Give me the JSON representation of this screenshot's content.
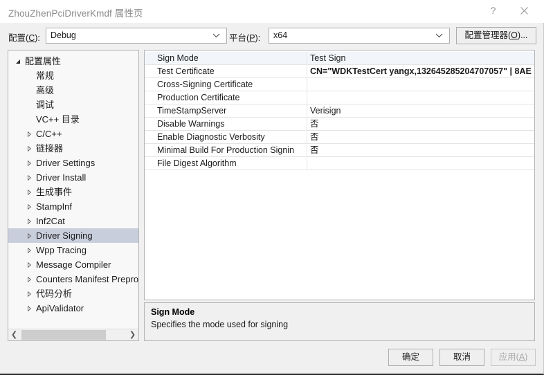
{
  "window": {
    "title": "ZhouZhenPciDriverKmdf 属性页",
    "help_icon": "question-mark-icon",
    "close_icon": "close-icon"
  },
  "config_bar": {
    "config_label": "配置(C):",
    "config_label_plain": "配置",
    "config_accel": "C",
    "config_value": "Debug",
    "platform_label": "平台(P):",
    "platform_label_plain": "平台",
    "platform_accel": "P",
    "platform_value": "x64",
    "config_manager_button": "配置管理器(O)...",
    "config_manager_plain": "配置管理器",
    "config_manager_accel": "O",
    "chevron_icon": "chevron-down-icon"
  },
  "tree": {
    "items": [
      {
        "label": "配置属性",
        "level": 0,
        "expander": "expanded",
        "selected": false
      },
      {
        "label": "常规",
        "level": 1,
        "expander": "none",
        "selected": false
      },
      {
        "label": "高级",
        "level": 1,
        "expander": "none",
        "selected": false
      },
      {
        "label": "调试",
        "level": 1,
        "expander": "none",
        "selected": false
      },
      {
        "label": "VC++ 目录",
        "level": 1,
        "expander": "none",
        "selected": false
      },
      {
        "label": "C/C++",
        "level": 1,
        "expander": "collapsed",
        "selected": false
      },
      {
        "label": "链接器",
        "level": 1,
        "expander": "collapsed",
        "selected": false
      },
      {
        "label": "Driver Settings",
        "level": 1,
        "expander": "collapsed",
        "selected": false
      },
      {
        "label": "Driver Install",
        "level": 1,
        "expander": "collapsed",
        "selected": false
      },
      {
        "label": "生成事件",
        "level": 1,
        "expander": "collapsed",
        "selected": false
      },
      {
        "label": "StampInf",
        "level": 1,
        "expander": "collapsed",
        "selected": false
      },
      {
        "label": "Inf2Cat",
        "level": 1,
        "expander": "collapsed",
        "selected": false
      },
      {
        "label": "Driver Signing",
        "level": 1,
        "expander": "collapsed",
        "selected": true
      },
      {
        "label": "Wpp Tracing",
        "level": 1,
        "expander": "collapsed",
        "selected": false
      },
      {
        "label": "Message Compiler",
        "level": 1,
        "expander": "collapsed",
        "selected": false
      },
      {
        "label": "Counters Manifest Preproc",
        "level": 1,
        "expander": "collapsed",
        "selected": false
      },
      {
        "label": "代码分析",
        "level": 1,
        "expander": "collapsed",
        "selected": false
      },
      {
        "label": "ApiValidator",
        "level": 1,
        "expander": "collapsed",
        "selected": false
      }
    ],
    "scrollbar": {
      "left_arrow_icon": "chevron-left-icon",
      "right_arrow_icon": "chevron-right-icon"
    }
  },
  "grid": {
    "rows": [
      {
        "name": "Sign Mode",
        "value": "Test Sign",
        "bold": false,
        "selected": true
      },
      {
        "name": "Test Certificate",
        "value": "CN=\"WDKTestCert yangx,132645285204707057\" | 8AE",
        "bold": true,
        "selected": false
      },
      {
        "name": "Cross-Signing Certificate",
        "value": "",
        "bold": false,
        "selected": false
      },
      {
        "name": "Production Certificate",
        "value": "",
        "bold": false,
        "selected": false
      },
      {
        "name": "TimeStampServer",
        "value": "Verisign",
        "bold": false,
        "selected": false
      },
      {
        "name": "Disable Warnings",
        "value": "否",
        "bold": false,
        "selected": false
      },
      {
        "name": "Enable Diagnostic Verbosity",
        "value": "否",
        "bold": false,
        "selected": false
      },
      {
        "name": "Minimal Build For Production Signin",
        "value": "否",
        "bold": false,
        "selected": false
      },
      {
        "name": "File Digest Algorithm",
        "value": "",
        "bold": false,
        "selected": false
      }
    ]
  },
  "description": {
    "title": "Sign Mode",
    "body": "Specifies the mode used for signing"
  },
  "footer": {
    "ok": "确定",
    "cancel": "取消",
    "apply": "应用(A)",
    "apply_plain": "应用",
    "apply_accel": "A",
    "apply_enabled": false
  },
  "colors": {
    "dialog_bg": "#f0f0f0",
    "panel_bg": "#ffffff",
    "tree_bg": "#f8f8f8",
    "tree_selection": "#c9cedd",
    "grid_selection": "#f2f6fb",
    "border": "#b4b4b4",
    "title_text": "#8a8a8a",
    "disabled_text": "#a8a8a8"
  }
}
